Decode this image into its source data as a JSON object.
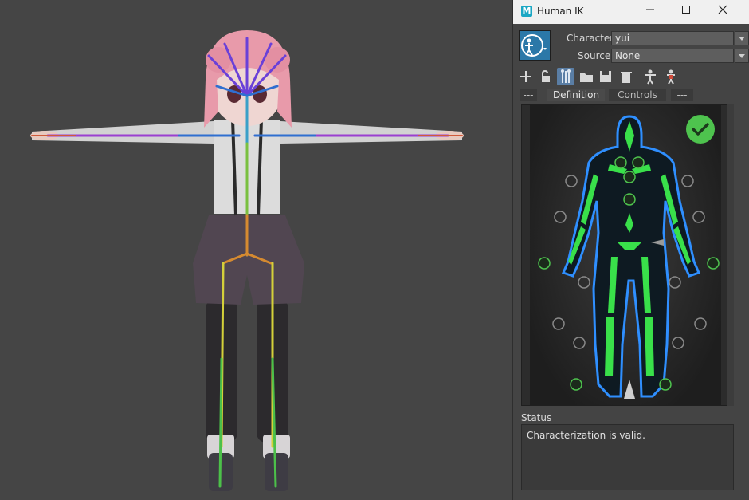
{
  "window": {
    "title": "Human IK",
    "app_logo": "M",
    "controls": [
      "minimize-icon",
      "maximize-icon",
      "close-icon"
    ]
  },
  "character": {
    "label": "Character:",
    "value": "yui"
  },
  "source": {
    "label": "Source:",
    "value": "None"
  },
  "toolbar": {
    "icons": [
      "add-icon",
      "lock-icon",
      "skeleton-icon",
      "open-folder-icon",
      "save-icon",
      "trash-icon",
      "figure-icon",
      "figure-pose-icon"
    ]
  },
  "tabs": [
    {
      "label": "---"
    },
    {
      "label": "Definition",
      "active": true
    },
    {
      "label": "Controls"
    },
    {
      "label": "---"
    }
  ],
  "status": {
    "label": "Status",
    "message": "Characterization is valid."
  },
  "colors": {
    "valid": "#4ec34e",
    "bone": "#39e04a",
    "outline": "#2f8fff",
    "accent": "#5a7ea5"
  }
}
